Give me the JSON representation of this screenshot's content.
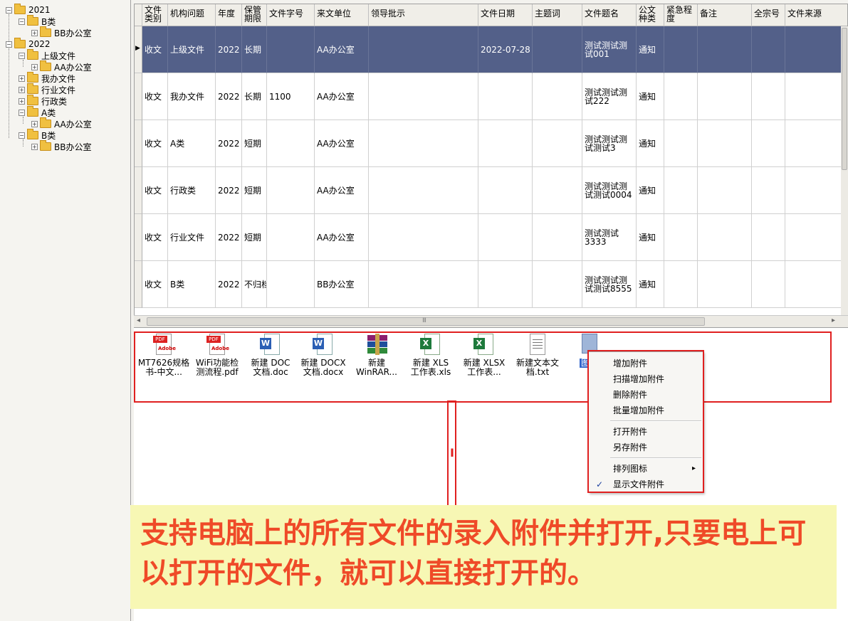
{
  "tree": [
    {
      "label": "2021",
      "expanded": true
    },
    {
      "label": "B类",
      "expanded": true
    },
    {
      "label": "BB办公室",
      "expanded": false
    },
    {
      "label": "2022",
      "expanded": true
    },
    {
      "label": "上级文件",
      "expanded": true
    },
    {
      "label": "AA办公室",
      "expanded": false
    },
    {
      "label": "我办文件",
      "expanded": false
    },
    {
      "label": "行业文件",
      "expanded": false
    },
    {
      "label": "行政类",
      "expanded": false
    },
    {
      "label": "A类",
      "expanded": true
    },
    {
      "label": "AA办公室",
      "expanded": false
    },
    {
      "label": "B类",
      "expanded": true
    },
    {
      "label": "BB办公室",
      "expanded": false
    }
  ],
  "grid": {
    "columns": [
      "文件\n类别",
      "机构问题",
      "年度",
      "保管\n期限",
      "文件字号",
      "来文单位",
      "领导批示",
      "文件日期",
      "主题词",
      "文件题名",
      "公文\n种类",
      "紧急程\n度",
      "备注",
      "全宗号",
      "文件来源"
    ],
    "rows": [
      [
        "收文",
        "上级文件",
        "2022",
        "长期",
        "",
        "AA办公室",
        "",
        "2022-07-28",
        "",
        "测试测试测\n试001",
        "通知",
        "",
        "",
        "",
        ""
      ],
      [
        "收文",
        "我办文件",
        "2022",
        "长期",
        "1100",
        "AA办公室",
        "",
        "",
        "",
        "测试测试测\n试222",
        "通知",
        "",
        "",
        "",
        ""
      ],
      [
        "收文",
        "A类",
        "2022",
        "短期",
        "",
        "AA办公室",
        "",
        "",
        "",
        "测试测试测\n试测试3",
        "通知",
        "",
        "",
        "",
        ""
      ],
      [
        "收文",
        "行政类",
        "2022",
        "短期",
        "",
        "AA办公室",
        "",
        "",
        "",
        "测试测试测\n试测试0004",
        "通知",
        "",
        "",
        "",
        ""
      ],
      [
        "收文",
        "行业文件",
        "2022",
        "短期",
        "",
        "AA办公室",
        "",
        "",
        "",
        "测试测试\n3333",
        "通知",
        "",
        "",
        "",
        ""
      ],
      [
        "收文",
        "B类",
        "2022",
        "不归档",
        "",
        "BB办公室",
        "",
        "",
        "",
        "测试测试测\n试测试8555",
        "通知",
        "",
        "",
        "",
        ""
      ]
    ],
    "selected_row": 0,
    "scroll_arrow_left": "◂",
    "scroll_arrow_right": "▸",
    "scroll_grip": "III",
    "row_pointer": "▶"
  },
  "attachments": [
    {
      "name": "MT7626规格\n书-中文...",
      "icon": "pdf-icon"
    },
    {
      "name": "WiFi功能检\n测流程.pdf",
      "icon": "pdf-icon"
    },
    {
      "name": "新建 DOC\n文档.doc",
      "icon": "word-icon"
    },
    {
      "name": "新建 DOCX\n文档.docx",
      "icon": "word-icon"
    },
    {
      "name": "新建\nWinRAR...",
      "icon": "winrar-icon"
    },
    {
      "name": "新建 XLS\n工作表.xls",
      "icon": "excel-icon"
    },
    {
      "name": "新建 XLSX\n工作表...",
      "icon": "excel-icon"
    },
    {
      "name": "新建文本文\n档.txt",
      "icon": "text-file-icon"
    },
    {
      "name": "图片",
      "icon": "image-icon"
    }
  ],
  "icon_labels": {
    "pdf": "PDF",
    "adobe": "Adobe",
    "word": "W",
    "excel": "X"
  },
  "context_menu": {
    "items": [
      "增加附件",
      "扫描增加附件",
      "删除附件",
      "批量增加附件",
      "打开附件",
      "另存附件",
      "排列图标",
      "显示文件附件"
    ],
    "submenu_arrow": "▸",
    "checkmark": "✓",
    "cursor_mark": "I"
  },
  "note": "支持电脑上的所有文件的录入附件并打开,只要电上可以打开的文件，就可以直接打开的。",
  "colors": {
    "selected_row": "#536089",
    "highlight": "#e02020",
    "note_bg": "#f7f7b4",
    "note_text": "#ef4a28"
  }
}
